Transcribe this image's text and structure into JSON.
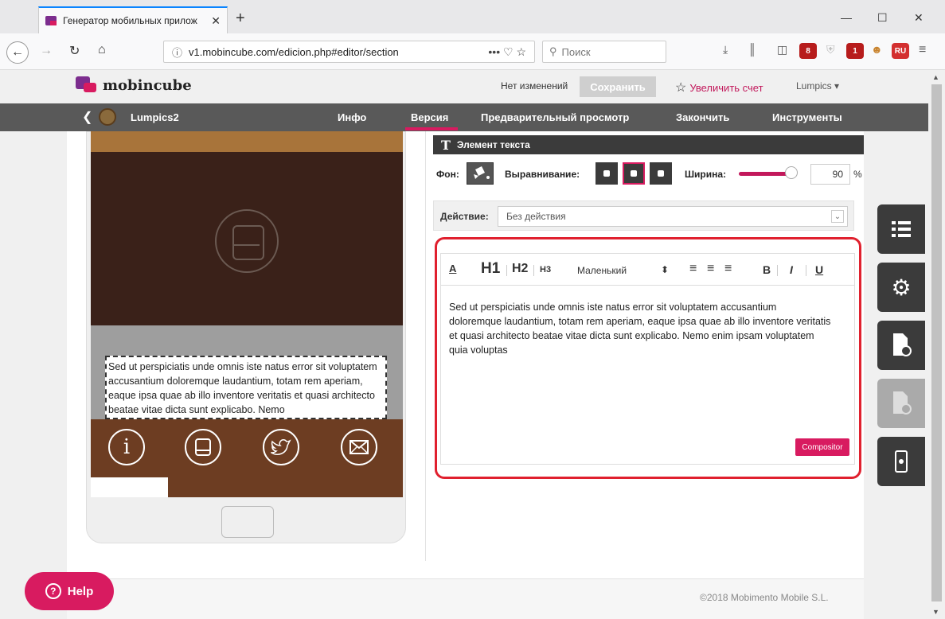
{
  "browser": {
    "tab_title": "Генератор мобильных прилож",
    "tab_close": "✕",
    "new_tab": "+",
    "url_info_icon": "info-icon",
    "url": "v1.mobincube.com/edicion.php#editor/section",
    "url_tools": "••• ♡ ☆",
    "search_placeholder": "Поиск",
    "badge1": "8",
    "badge2": "1",
    "badge3": "RU"
  },
  "app": {
    "logo_text": "mobincube",
    "status": "Нет изменений",
    "save_label": "Сохранить",
    "upgrade_label": "Увеличить счет",
    "user_label": "Lumpics ▾",
    "project_name": "Lumpics2",
    "nav": [
      "Инфо",
      "Версия",
      "Предварительный просмотр",
      "Закончить",
      "Инструменты"
    ],
    "active_nav": "Версия"
  },
  "preview": {
    "text": "Sed ut perspiciatis unde omnis iste natus error sit voluptatem accusantium doloremque laudantium, totam rem aperiam, eaque ipsa quae ab illo inventore veritatis et quasi architecto beatae vitae dicta sunt explicabo. Nemo"
  },
  "panel": {
    "title": "Элемент текста",
    "bg_label": "Фон:",
    "align_label": "Выравнивание:",
    "width_label": "Ширина:",
    "width_value": "90",
    "width_unit": "%",
    "width_level_percent": 90,
    "action_label": "Действие:",
    "action_value": "Без действия"
  },
  "editor": {
    "toolbar": {
      "color": "A",
      "h1": "H1",
      "h2": "H2",
      "h3": "H3",
      "size": "Маленький",
      "size_arrows": "⬍",
      "bold": "B",
      "italic": "I",
      "underline": "U"
    },
    "text": "Sed ut perspiciatis unde omnis iste natus error sit voluptatem accusantium doloremque laudantium, totam rem aperiam, eaque ipsa quae ab illo inventore veritatis et quasi architecto beatae vitae dicta sunt explicabo. Nemo enim ipsam voluptatem quia voluptas",
    "compositor_label": "Compositor"
  },
  "footer": {
    "help_label": "Help",
    "copyright": "©2018 Mobimento Mobile S.L."
  },
  "colors": {
    "accent": "#d81b60",
    "purple": "#7c2d8e",
    "nav_bg": "#595959",
    "highlight": "#e0202e"
  }
}
